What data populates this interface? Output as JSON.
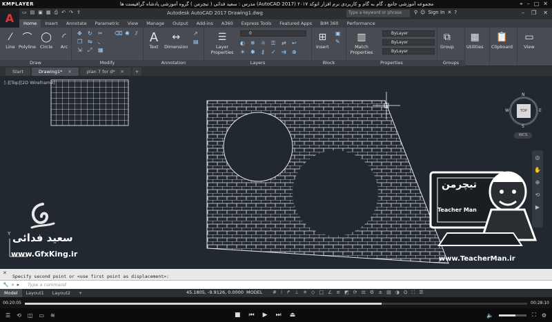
{
  "player": {
    "logo": "KMPLAYER",
    "title": "مجموعه آموزشی جامع ، گام به گام و کاربردی نرم افزار اتوکد ۲۰۱۷ (AutoCAD 2017) مدرس : سعید فدائی ( تیچرمن ) گروه آموزشی پادشاه گرافیست ها",
    "time_elapsed": "00:20:05",
    "time_total": "00:28:10",
    "progress": 0.71,
    "volume": 0.6
  },
  "acad": {
    "document_title": "Autodesk AutoCAD 2017    Drawing1.dwg",
    "search_placeholder": "Type a keyword or phrase",
    "sign_in": "Sign In"
  },
  "ribbon_tabs": [
    "Home",
    "Insert",
    "Annotate",
    "Parametric",
    "View",
    "Manage",
    "Output",
    "Add-ins",
    "A360",
    "Express Tools",
    "Featured Apps",
    "BIM 360",
    "Performance"
  ],
  "ribbon": {
    "draw": {
      "label": "Draw",
      "line": "Line",
      "polyline": "Polyline",
      "circle": "Circle",
      "arc": "Arc"
    },
    "modify": {
      "label": "Modify"
    },
    "annotation": {
      "label": "Annotation",
      "text": "Text",
      "dimension": "Dimension"
    },
    "layers": {
      "label": "Layers",
      "layer_properties": "Layer Properties",
      "layer_value": "0"
    },
    "block": {
      "label": "Block",
      "insert": "Insert"
    },
    "properties": {
      "label": "Properties",
      "match": "Match Properties",
      "color": "ByLayer",
      "linetype": "ByLayer",
      "lineweight": "ByLayer"
    },
    "groups": {
      "label": "Groups",
      "group": "Group"
    },
    "utilities": "Utilities",
    "clipboard": "Clipboard",
    "view": "View"
  },
  "file_tabs": [
    "Start",
    "Drawing1*",
    "plan 7 for d*"
  ],
  "viewport": {
    "label": "[-][Top][2D Wireframe]",
    "viewcube_top": "TOP",
    "viewcube_n": "N",
    "viewcube_s": "S",
    "viewcube_e": "E",
    "viewcube_w": "W",
    "wcs": "WCS",
    "axis_y": "Y"
  },
  "command": {
    "history": "Specify second point or <use first point as displacement>:",
    "placeholder": "Type a command"
  },
  "status": {
    "layout_tabs": [
      "Model",
      "Layout1",
      "Layout2"
    ],
    "coords": "45.1805, -9.9126, 0.0000",
    "model": "MODEL"
  },
  "watermarks": {
    "author": "سعید فدائی",
    "site_left": "www.GfxKing.ir",
    "site_right": "www.TeacherMan.ir",
    "brand": "تیچرمن",
    "brand_en": "Teacher Man"
  }
}
